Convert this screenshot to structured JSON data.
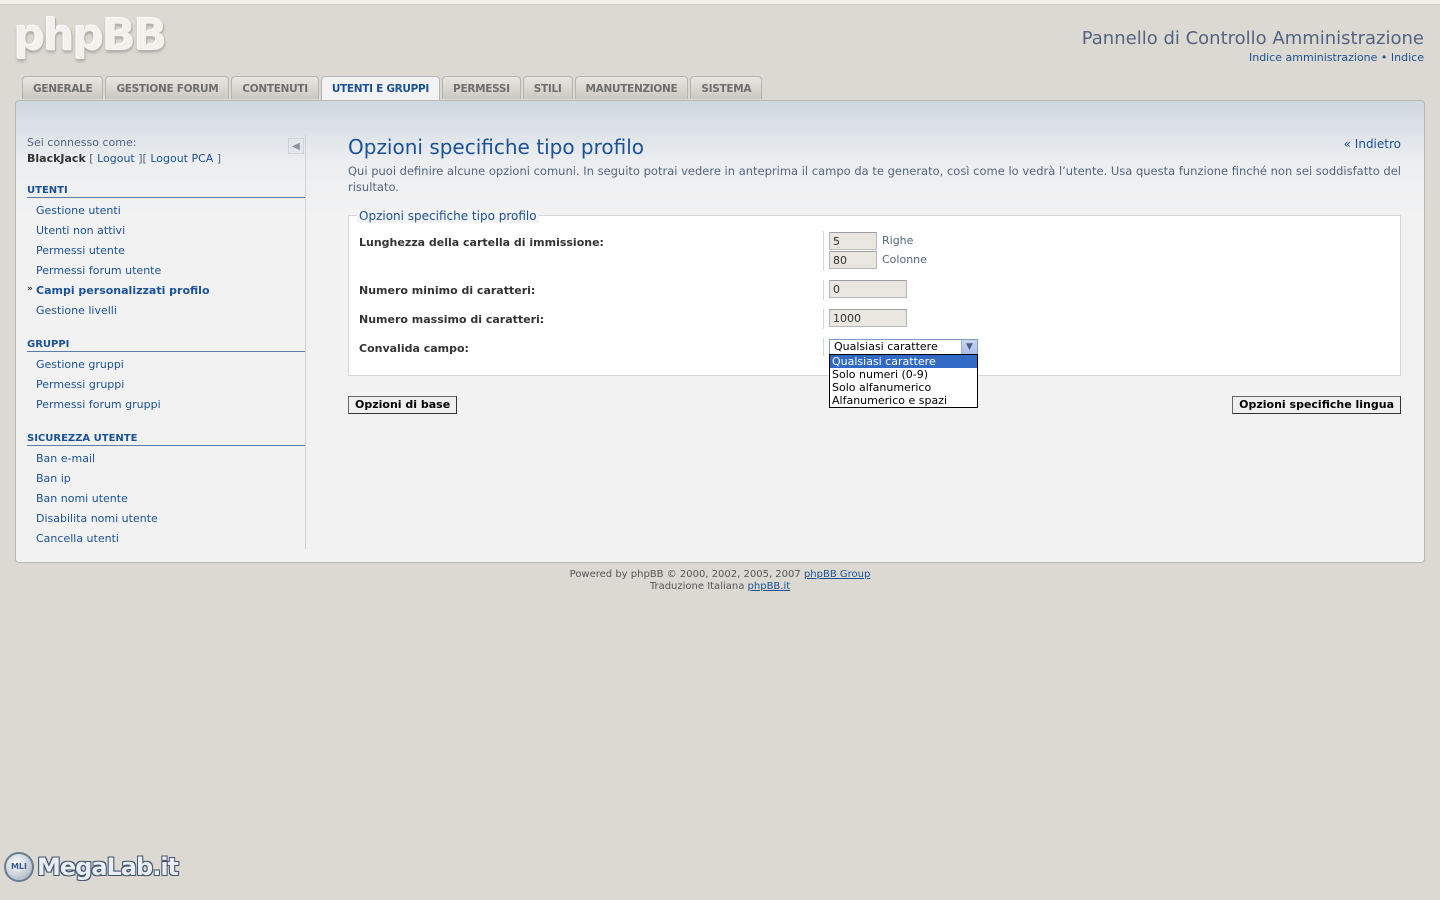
{
  "header": {
    "logo": "phpBB",
    "acp_title": "Pannello di Controllo Amministrazione",
    "links": [
      "Indice amministrazione",
      "Indice"
    ],
    "link_separator": "•"
  },
  "tabs": [
    {
      "label": "GENERALE",
      "active": false
    },
    {
      "label": "GESTIONE FORUM",
      "active": false
    },
    {
      "label": "CONTENUTI",
      "active": false
    },
    {
      "label": "UTENTI E GRUPPI",
      "active": true
    },
    {
      "label": "PERMESSI",
      "active": false
    },
    {
      "label": "STILI",
      "active": false
    },
    {
      "label": "MANUTENZIONE",
      "active": false
    },
    {
      "label": "SISTEMA",
      "active": false
    }
  ],
  "sidebar": {
    "logged_as_label": "Sei connesso come:",
    "username": "BlackJack",
    "logout": "Logout",
    "logout_acp": "Logout PCA",
    "collapse_icon": "collapse-left-icon",
    "sections": [
      {
        "title": "UTENTI",
        "items": [
          "Gestione utenti",
          "Utenti non attivi",
          "Permessi utente",
          "Permessi forum utente",
          "Campi personalizzati profilo",
          "Gestione livelli"
        ]
      },
      {
        "title": "GRUPPI",
        "items": [
          "Gestione gruppi",
          "Permessi gruppi",
          "Permessi forum gruppi"
        ]
      },
      {
        "title": "SICUREZZA UTENTE",
        "items": [
          "Ban e-mail",
          "Ban ip",
          "Ban nomi utente",
          "Disabilita nomi utente",
          "Cancella utenti"
        ]
      }
    ],
    "current_item": "Campi personalizzati profilo"
  },
  "main": {
    "title": "Opzioni specifiche tipo profilo",
    "back_link": "« Indietro",
    "description": "Qui puoi definire alcune opzioni comuni. In seguito potrai vedere in anteprima il campo da te generato, così come lo vedrà l’utente. Usa questa funzione finché non sei soddisfatto del risultato.",
    "fieldset_legend": "Opzioni specifiche tipo profilo",
    "fields": {
      "length_label": "Lunghezza della cartella di immissione:",
      "rows_value": "5",
      "rows_unit": "Righe",
      "cols_value": "80",
      "cols_unit": "Colonne",
      "min_label": "Numero minimo di caratteri:",
      "min_value": "0",
      "max_label": "Numero massimo di caratteri:",
      "max_value": "1000",
      "validate_label": "Convalida campo:",
      "validate_selected": "Qualsiasi carattere",
      "validate_options": [
        "Qualsiasi carattere",
        "Solo numeri (0-9)",
        "Solo alfanumerico",
        "Alfanumerico e spazi"
      ]
    },
    "btn_base": "Opzioni di base",
    "btn_lang": "Opzioni specifiche lingua"
  },
  "footer": {
    "powered_prefix": "Powered by phpBB © 2000, 2002, 2005, 2007",
    "powered_link": "phpBB Group",
    "translation_prefix": "Traduzione Italiana",
    "translation_link": "phpBB.it"
  },
  "watermark": {
    "badge": "MLI",
    "text": "MegaLab.it"
  }
}
